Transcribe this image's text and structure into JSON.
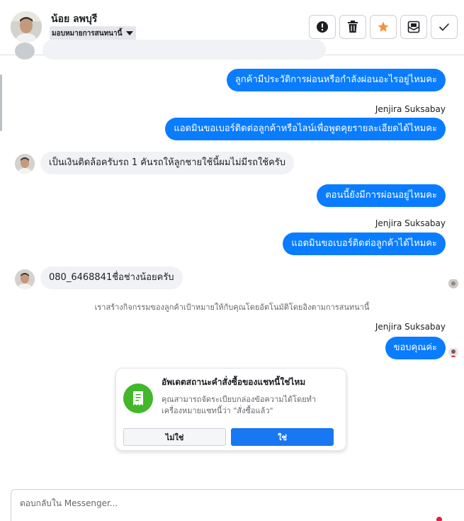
{
  "header": {
    "contact_name": "น้อย ลพบุรี",
    "assign_label": "มอบหมายการสนทนานี้",
    "actions": {
      "spam": "alert-icon",
      "delete": "trash-icon",
      "star": "star-icon",
      "unread": "envelope-icon",
      "done": "check-icon"
    },
    "star_color": "#f7923b"
  },
  "messages": [
    {
      "direction": "outgoing",
      "text": "ลูกค้ามีประวัติการผ่อนหรือกำลังผ่อนอะไรอยู่ไหมคะ"
    },
    {
      "direction": "outgoing",
      "sender": "Jenjira Suksabay",
      "text": "แอดมินขอเบอร์ติดต่อลูกค้าหรือไลน์เพื่อพูดคุยรายละเอียดได้ไหมคะ"
    },
    {
      "direction": "incoming",
      "text": "เป็นเงินติดล้อครับรถ 1 คันรถให้ลูกชายใช้นี้ผมไม่มีรถใช้ครับ"
    },
    {
      "direction": "outgoing",
      "text": "ตอนนี้ยังมีการผ่อนอยู่ไหมคะ"
    },
    {
      "direction": "outgoing",
      "sender": "Jenjira Suksabay",
      "text": "แอดมินขอเบอร์ติดต่อลูกค้าได้ไหมคะ"
    },
    {
      "direction": "incoming",
      "text": "080_6468841ชื่อช่างน้อยครับ"
    },
    {
      "direction": "outgoing",
      "sender": "Jenjira Suksabay",
      "text": "ขอบคุณค่ะ"
    }
  ],
  "system_note": "เราสร้างกิจกรรมของลูกค้าเป้าหมายให้กับคุณโดยอัตโนมัติโดยอิงตามการสนทนานี้",
  "order_card": {
    "title": "อัพเดตสถานะคำสั่งซื้อของแชทนี้ใช่ไหม",
    "body": "คุณสามารถจัดระเบียบกล่องข้อความได้โดยทำเครื่องหมายแชทนี้ว่า \"สั่งซื้อแล้ว\"",
    "no_label": "ไม่ใช่",
    "yes_label": "ใช่",
    "icon": "receipt-icon"
  },
  "composer": {
    "placeholder": "ตอบกลับใน Messenger..."
  },
  "colors": {
    "outgoing_bubble": "#0a7cff",
    "incoming_bubble": "#f0f2f5",
    "primary_button": "#1877f2",
    "card_icon_bg": "#42b72a"
  }
}
